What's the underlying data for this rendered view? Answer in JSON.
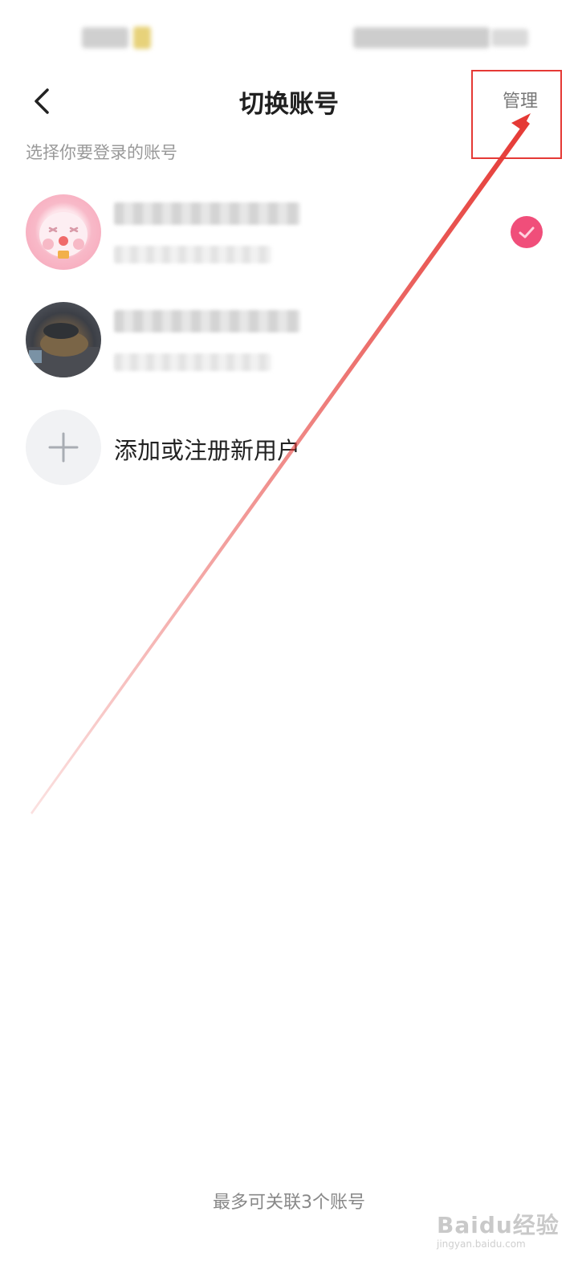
{
  "header": {
    "title": "切换账号",
    "manage_label": "管理"
  },
  "subtitle": "选择你要登录的账号",
  "accounts": [
    {
      "avatar": "pink-cartoon-avatar",
      "selected": true
    },
    {
      "avatar": "photo-avatar",
      "selected": false
    }
  ],
  "add_account": {
    "label": "添加或注册新用户"
  },
  "footer_note": "最多可关联3个账号",
  "watermark": {
    "brand": "Baidu经验",
    "url": "jingyan.baidu.com"
  },
  "colors": {
    "annotation_red": "#e53935",
    "accent_pink": "#f04e7a"
  }
}
